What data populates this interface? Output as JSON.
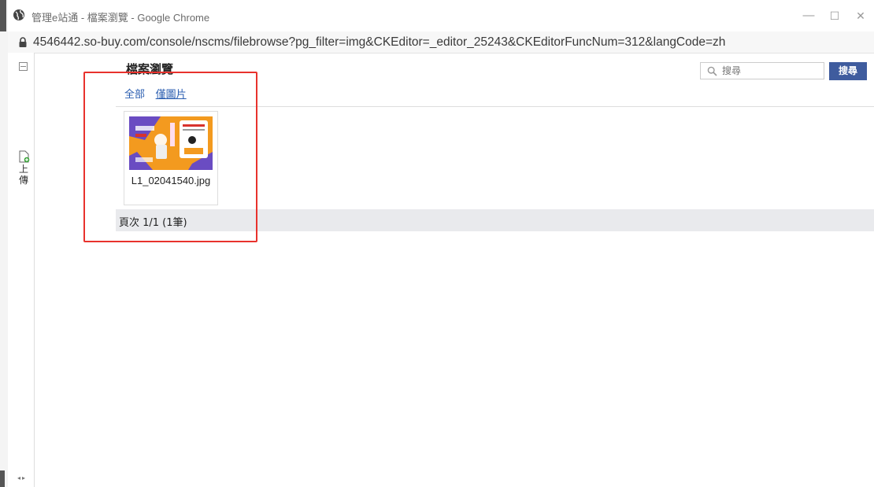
{
  "window": {
    "title": "管理e站通 - 檔案瀏覽 - Google Chrome",
    "url": "4546442.so-buy.com/console/nscms/filebrowse?pg_filter=img&CKEditor=_editor_25243&CKEditorFuncNum=312&langCode=zh",
    "controls": {
      "minimize": "—",
      "maximize": "☐",
      "close": "✕"
    }
  },
  "sidebar": {
    "upload_label": "上傳"
  },
  "page": {
    "title": "檔案瀏覽",
    "filters": [
      {
        "label": "全部",
        "active": false
      },
      {
        "label": "僅圖片",
        "active": true
      }
    ],
    "search": {
      "placeholder": "搜尋",
      "button_label": "搜尋"
    }
  },
  "files": [
    {
      "name": "L1_02041540.jpg",
      "thumb_colors": {
        "bg": "#f39a1f",
        "accent": "#6a4cc2"
      }
    }
  ],
  "footer": {
    "pager_text": "頁次 1/1 (1筆)"
  },
  "colors": {
    "highlight": "#e8322d",
    "button": "#3f5c9e",
    "link": "#2a5db0"
  }
}
